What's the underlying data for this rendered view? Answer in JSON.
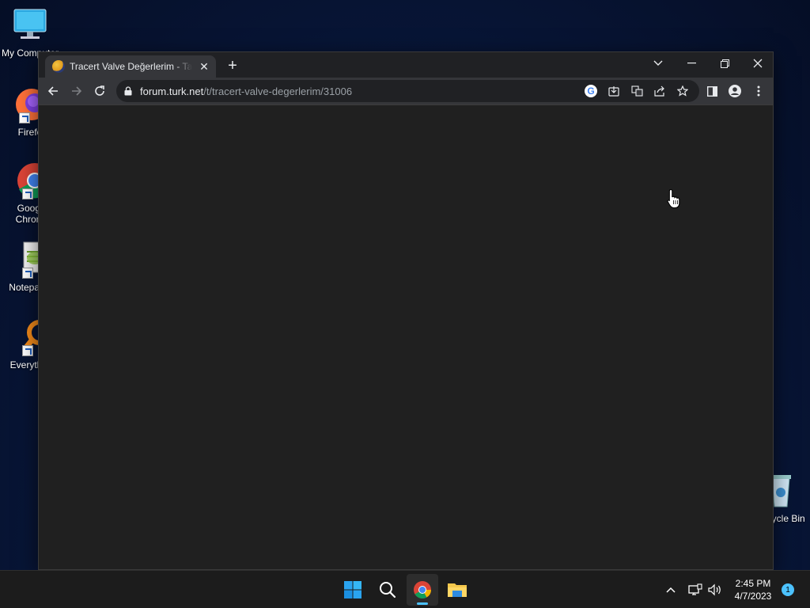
{
  "desktop": {
    "icons": [
      {
        "label": "My Computer"
      },
      {
        "label": "Firefox"
      },
      {
        "label": "Google Chrome"
      },
      {
        "label": "Notepad++"
      },
      {
        "label": "Everything"
      },
      {
        "label": "Recycle Bin"
      }
    ]
  },
  "browser": {
    "tab": {
      "title": "Tracert Valve Değerlerim - Talepler",
      "close": "✕"
    },
    "new_tab": "+",
    "window_controls": {
      "tab_search": "⌄",
      "minimize": "—",
      "restore": "❐",
      "close": "✕"
    },
    "omnibox": {
      "host": "forum.turk.net",
      "path": "/t/tracert-valve-degerlerim/31006"
    },
    "google_glyph": "G"
  },
  "taskbar": {
    "clock_time": "2:45 PM",
    "clock_date": "4/7/2023",
    "notification_count": "1"
  },
  "colors": {
    "accent": "#4cc2ff",
    "window_bg": "#202020",
    "toolbar_bg": "#35363a"
  }
}
